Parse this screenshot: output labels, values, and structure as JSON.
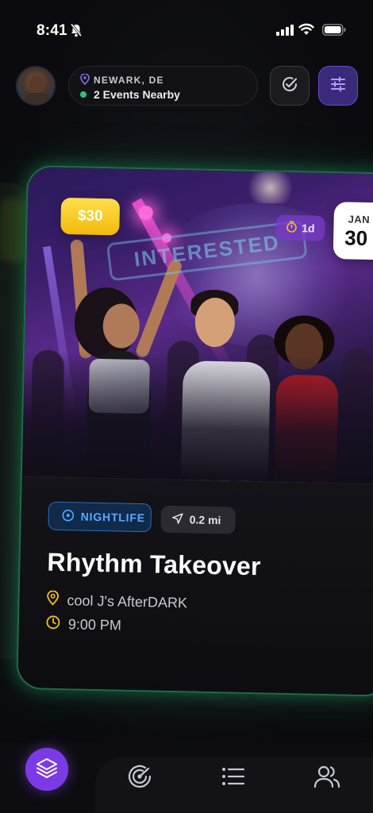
{
  "status_bar": {
    "time": "8:41"
  },
  "header": {
    "city": "NEWARK, DE",
    "nearby": "2 Events Nearby"
  },
  "event": {
    "price": "$30",
    "countdown": "1d",
    "date_month": "JAN",
    "date_day": "30",
    "stamp": "INTERESTED",
    "category": "NIGHTLIFE",
    "distance": "0.2 mi",
    "title": "Rhythm Takeover",
    "venue": "cool J's AfterDARK",
    "time": "9:00 PM"
  },
  "colors": {
    "accent_purple": "#7c3ae6",
    "glow_green": "#28dc82",
    "category_blue": "#5aa8ff",
    "price_yellow": "#f2b90a",
    "icon_gold": "#f2c40a"
  },
  "icons": {
    "status": [
      "bell-slash-icon",
      "signal-icon",
      "wifi-icon",
      "battery-icon"
    ],
    "header": [
      "map-pin-icon",
      "check-circle-icon",
      "sliders-icon"
    ],
    "nav": [
      "layers-icon",
      "radar-icon",
      "list-icon",
      "people-icon"
    ]
  }
}
